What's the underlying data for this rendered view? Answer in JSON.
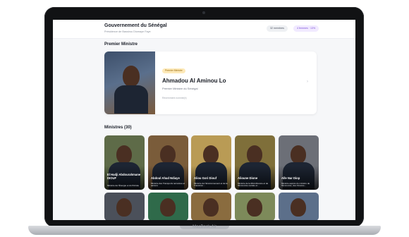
{
  "header": {
    "title": "Gouvernement du Sénégal",
    "subtitle": "Présidence de Bassirou Diomaye Faye",
    "members_pill": "32 membres",
    "women_pill": "4 femmes · 13%"
  },
  "pm_section": {
    "heading": "Premier Ministre",
    "badge": "Premier Ministre",
    "name": "Ahmadou Al Aminou Lo",
    "role": "Premier Ministre du Sénégal",
    "meta": "Récemment nommé(e)"
  },
  "ministers_section": {
    "heading": "Ministres (30)",
    "cards": [
      {
        "name": "El Hadji Abdourahmane DIOUF",
        "role": "Ministre de l'Énergie et du Pétrole",
        "bg": "#5e6b48"
      },
      {
        "name": "Abdoul Ahad Ndiaye",
        "role": "Ministre des Transports terrestres et aériens",
        "bg": "#7a5c3a"
      },
      {
        "name": "Aliou Gori Diouf",
        "role": "Ministre de l'Environnement et de la Transition...",
        "bg": "#b99b55"
      },
      {
        "name": "Alioune Dione",
        "role": "Ministre de la Microfinance et de l'Économie sociale et...",
        "bg": "#7f6f3a"
      },
      {
        "name": "Alle Nar Diop",
        "role": "Ministre auprès du ministre de l'Économie, des Finance...",
        "bg": "#6c6f77"
      }
    ],
    "row2": [
      {
        "bg": "#4b505a"
      },
      {
        "bg": "#2f6a4a"
      },
      {
        "bg": "#8a6c3f"
      },
      {
        "bg": "#7d8a5a"
      },
      {
        "bg": "#5c6f8a"
      }
    ]
  },
  "device": {
    "brand": "MacBook Air"
  }
}
